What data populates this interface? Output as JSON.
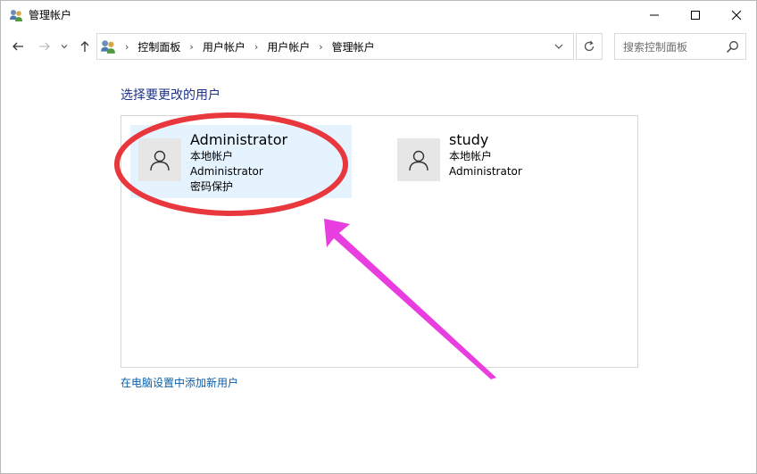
{
  "window": {
    "title": "管理帐户"
  },
  "navigation": {
    "breadcrumbs": [
      "控制面板",
      "用户帐户",
      "用户帐户",
      "管理帐户"
    ],
    "search_placeholder": "搜索控制面板"
  },
  "content": {
    "heading": "选择要更改的用户",
    "users": [
      {
        "name": "Administrator",
        "lines": [
          "本地帐户",
          "Administrator",
          "密码保护"
        ],
        "selected": true
      },
      {
        "name": "study",
        "lines": [
          "本地帐户",
          "Administrator"
        ],
        "selected": false
      }
    ],
    "add_user_link": "在电脑设置中添加新用户"
  },
  "colors": {
    "heading": "#1e3287",
    "link": "#0a5ea8",
    "selected_tile": "#e5f3ff",
    "annotation_ellipse": "#e8373d",
    "annotation_arrow": "#e83ee0"
  }
}
